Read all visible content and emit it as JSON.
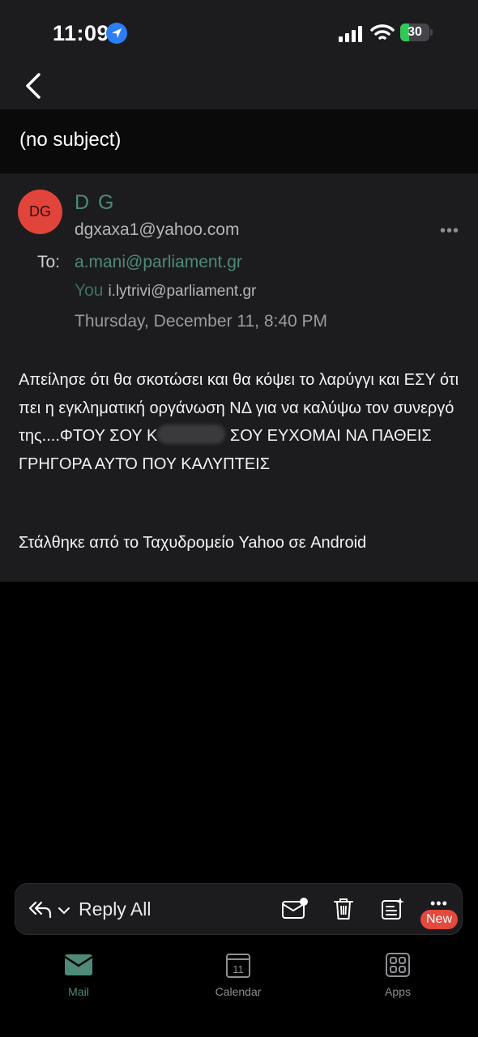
{
  "status_bar": {
    "time": "11:09",
    "battery_level": "30",
    "battery_fraction": 0.3,
    "accent": "#2b7ef5",
    "battery_color": "#34c759"
  },
  "nav": {
    "back_icon": "chevron-left-icon"
  },
  "email": {
    "subject": "(no subject)",
    "sender": {
      "initials": "DG",
      "name": "D G",
      "email": "dgxaxa1@yahoo.com",
      "avatar_color": "#e0443a"
    },
    "to_label": "To:",
    "recipients": [
      {
        "email": "a.mani@parliament.gr"
      },
      {
        "prefix": "You",
        "email": "i.lytrivi@parliament.gr"
      }
    ],
    "date": "Thursday, December 11, 8:40 PM",
    "body": {
      "line_part_1": "Απείλησε ότι θα σκοτώσει και θα κόψει το λαρύγγι και ΕΣΥ ότι πει η εγκληματική οργάνωση ΝΔ για να καλύψω τον συνεργό της....ΦΤΟΥ ΣΟΥ Κ",
      "line_part_2": " ΣΟΥ ΕΥΧΟΜΑΙ ΝΑ ΠΑΘΕΙΣ ΓΡΗΓΟΡΑ ΑΥΤΌ ΠΟΥ ΚΑΛΥΠΤΕΙΣ",
      "signature": "Στάλθηκε από το Ταχυδρομείο Yahoo σε Android"
    },
    "more_options": "•••"
  },
  "action_bar": {
    "reply_all_label": "Reply All",
    "more_label": "•••",
    "new_badge": "New",
    "icons": [
      "reply-all-icon",
      "chevron-down-icon",
      "mark-unread-icon",
      "trash-icon",
      "add-note-icon",
      "more-icon"
    ]
  },
  "tab_bar": {
    "tabs": [
      {
        "label": "Mail",
        "icon": "mail-icon"
      },
      {
        "label": "Calendar",
        "icon": "calendar-icon",
        "day": "11"
      },
      {
        "label": "Apps",
        "icon": "apps-grid-icon"
      }
    ],
    "active_color": "#4e8a78"
  }
}
